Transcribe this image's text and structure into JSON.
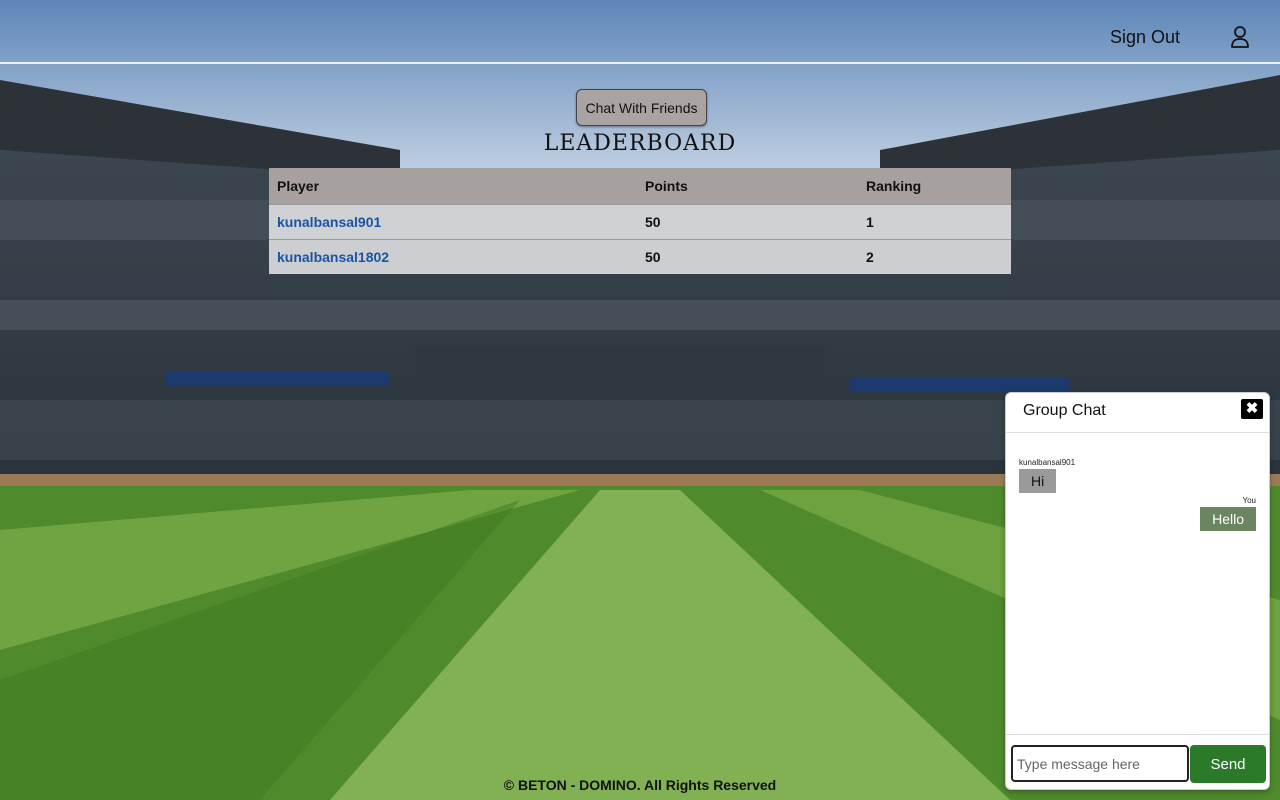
{
  "header": {
    "signout_label": "Sign Out",
    "user_icon": "user-icon"
  },
  "chat_button_label": "Chat With Friends",
  "leaderboard": {
    "title": "LEADERBOARD",
    "columns": [
      "Player",
      "Points",
      "Ranking"
    ],
    "rows": [
      {
        "player": "kunalbansal901",
        "points": "50",
        "ranking": "1"
      },
      {
        "player": "kunalbansal1802",
        "points": "50",
        "ranking": "2"
      }
    ]
  },
  "footer_text": "© BETON - DOMINO. All Rights Reserved",
  "group_chat": {
    "title": "Group Chat",
    "close_icon": "close-icon",
    "messages": [
      {
        "sender": "kunalbansal901",
        "text": "Hi"
      },
      {
        "sender": "You",
        "text": "Hello"
      }
    ],
    "input_placeholder": "Type message here",
    "send_label": "Send"
  },
  "colors": {
    "table_header": "#a6a19f",
    "player_link": "#1a55a3",
    "send_button": "#2a7a2a",
    "outgoing_bubble": "#6a8560",
    "incoming_bubble": "#9a9a9a"
  }
}
